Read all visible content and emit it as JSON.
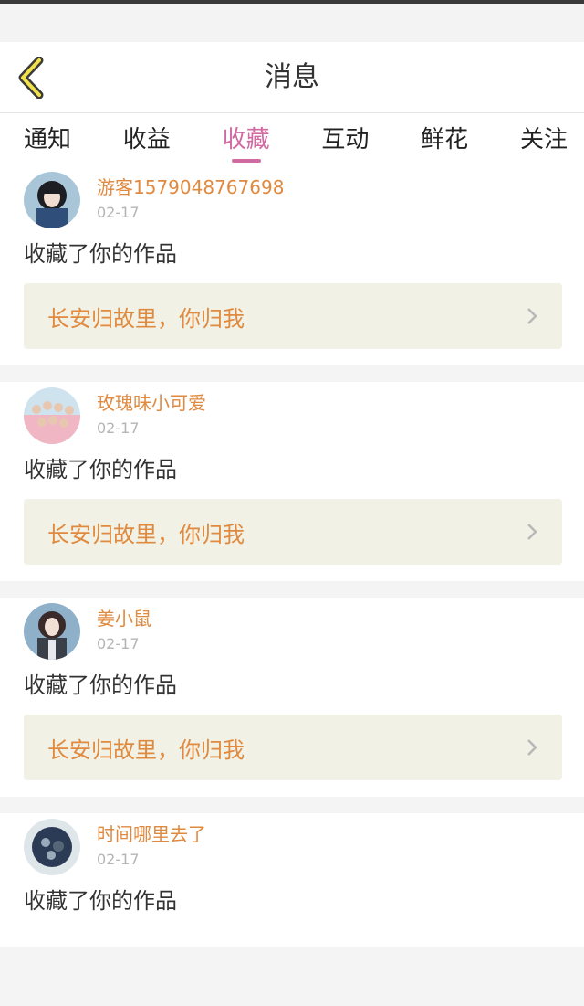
{
  "header": {
    "title": "消息",
    "back_icon": "back-chevron-icon"
  },
  "tabs": [
    {
      "label": "通知",
      "active": false
    },
    {
      "label": "收益",
      "active": false
    },
    {
      "label": "收藏",
      "active": true
    },
    {
      "label": "互动",
      "active": false
    },
    {
      "label": "鲜花",
      "active": false
    },
    {
      "label": "关注",
      "active": false
    }
  ],
  "colors": {
    "accent": "#d26aa2",
    "username": "#e08a3f",
    "back_icon_fill": "#f2e14a"
  },
  "notifications": [
    {
      "username": "游客1579048767698",
      "date": "02-17",
      "action": "收藏了你的作品",
      "work_title": "长安归故里，你归我"
    },
    {
      "username": "玫瑰味小可爱",
      "date": "02-17",
      "action": "收藏了你的作品",
      "work_title": "长安归故里，你归我"
    },
    {
      "username": "姜小鼠",
      "date": "02-17",
      "action": "收藏了你的作品",
      "work_title": "长安归故里，你归我"
    },
    {
      "username": "时间哪里去了",
      "date": "02-17",
      "action": "收藏了你的作品",
      "work_title": ""
    }
  ]
}
